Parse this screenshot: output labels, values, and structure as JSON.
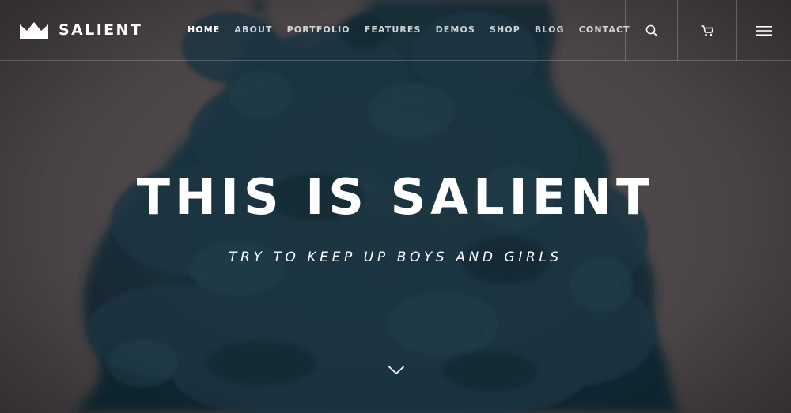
{
  "brand": {
    "name": "SALIENT",
    "logo_icon": "crown-icon"
  },
  "nav": {
    "items": [
      {
        "label": "HOME",
        "active": true
      },
      {
        "label": "ABOUT"
      },
      {
        "label": "PORTFOLIO"
      },
      {
        "label": "FEATURES"
      },
      {
        "label": "DEMOS"
      },
      {
        "label": "SHOP"
      },
      {
        "label": "BLOG"
      },
      {
        "label": "CONTACT"
      }
    ]
  },
  "header_actions": {
    "search_icon": "search-icon",
    "cart_icon": "cart-icon",
    "menu_icon": "hamburger-menu-icon"
  },
  "hero": {
    "title": "THIS IS SALIENT",
    "subtitle": "TRY TO KEEP UP BOYS AND GIRLS",
    "scroll_icon": "chevron-down-icon"
  },
  "colors": {
    "background": "#4a4447",
    "ink": "#17303b",
    "text": "#ffffff"
  }
}
